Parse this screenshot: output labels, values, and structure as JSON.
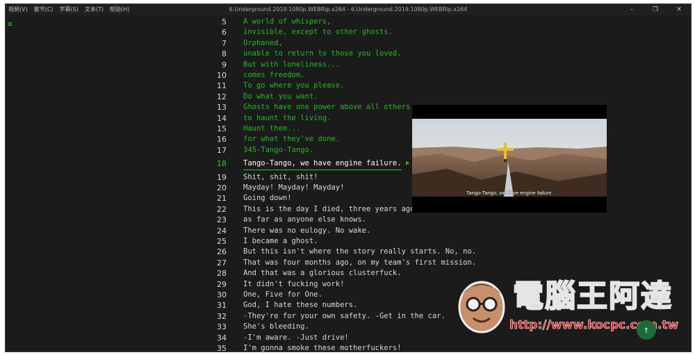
{
  "menu": [
    "视频(V)",
    "繁节(C)",
    "字幕(S)",
    "文本(T)",
    "帮助(H)"
  ],
  "window_title": "6.Underground.2019.1080p.WEBRip.x264 - 6.Underground.2019.1080p.WEBRip.x264",
  "window_controls": {
    "minimize": "–",
    "restore": "❐",
    "close": "✕"
  },
  "sidebar_icon": "list-icon",
  "current_line": 18,
  "lines": [
    {
      "n": "5",
      "text": "A world of whispers,",
      "state": "past"
    },
    {
      "n": "6",
      "text": "invisible, except to other ghosts.",
      "state": "past"
    },
    {
      "n": "7",
      "text": "Orphaned,",
      "state": "past"
    },
    {
      "n": "8",
      "text": "unable to return to those you loved.",
      "state": "past"
    },
    {
      "n": "9",
      "text": "But with loneliness...",
      "state": "past"
    },
    {
      "n": "10",
      "text": "comes freedom.",
      "state": "past"
    },
    {
      "n": "11",
      "text": "To go where you please.",
      "state": "past"
    },
    {
      "n": "12",
      "text": "Do what you want.",
      "state": "past"
    },
    {
      "n": "13",
      "text": "Ghosts have one power above all others.",
      "state": "past"
    },
    {
      "n": "14",
      "text": "to haunt the living.",
      "state": "past"
    },
    {
      "n": "15",
      "text": "Haunt them...",
      "state": "past"
    },
    {
      "n": "16",
      "text": "for what they've done.",
      "state": "past"
    },
    {
      "n": "17",
      "text": "345-Tango-Tango.",
      "state": "past"
    },
    {
      "n": "18",
      "text": "Tango-Tango, we have engine failure.",
      "state": "current"
    },
    {
      "n": "19",
      "text": "Shit, shit, shit!",
      "state": "future"
    },
    {
      "n": "20",
      "text": "Mayday! Mayday! Mayday!",
      "state": "future"
    },
    {
      "n": "21",
      "text": "Going down!",
      "state": "future"
    },
    {
      "n": "22",
      "text": "This is the day I died, three years ago",
      "state": "future"
    },
    {
      "n": "23",
      "text": "as far as anyone else knows.",
      "state": "future"
    },
    {
      "n": "24",
      "text": "There was no eulogy. No wake.",
      "state": "future"
    },
    {
      "n": "25",
      "text": "I became a ghost.",
      "state": "future"
    },
    {
      "n": "26",
      "text": "But this isn't where the story really starts. No, no.",
      "state": "future"
    },
    {
      "n": "27",
      "text": "That was four months ago, on my team's first mission.",
      "state": "future"
    },
    {
      "n": "28",
      "text": "And that was a glorious clusterfuck.",
      "state": "future"
    },
    {
      "n": "29",
      "text": "It didn't fucking work!",
      "state": "future"
    },
    {
      "n": "30",
      "text": "One, Five for One.",
      "state": "future"
    },
    {
      "n": "31",
      "text": "God, I hate these numbers.",
      "state": "future"
    },
    {
      "n": "32",
      "text": "-They're for your own safety. -Get in the car.",
      "state": "future"
    },
    {
      "n": "33",
      "text": "She's bleeding.",
      "state": "future"
    },
    {
      "n": "34",
      "text": "-I'm aware. -Just drive!",
      "state": "future"
    },
    {
      "n": "35",
      "text": "I'm gonna smoke these motherfuckers!",
      "state": "future"
    }
  ],
  "video": {
    "subtitle": "Tango-Tango, we have engine failure."
  },
  "watermark": {
    "text": "電腦王阿達",
    "url": "http://www.kocpc.com.tw"
  },
  "scroll_top_icon": "arrow-up-icon",
  "colors": {
    "accent": "#2ec22e",
    "background": "#1b1b1b",
    "text": "#d8d8d8"
  }
}
